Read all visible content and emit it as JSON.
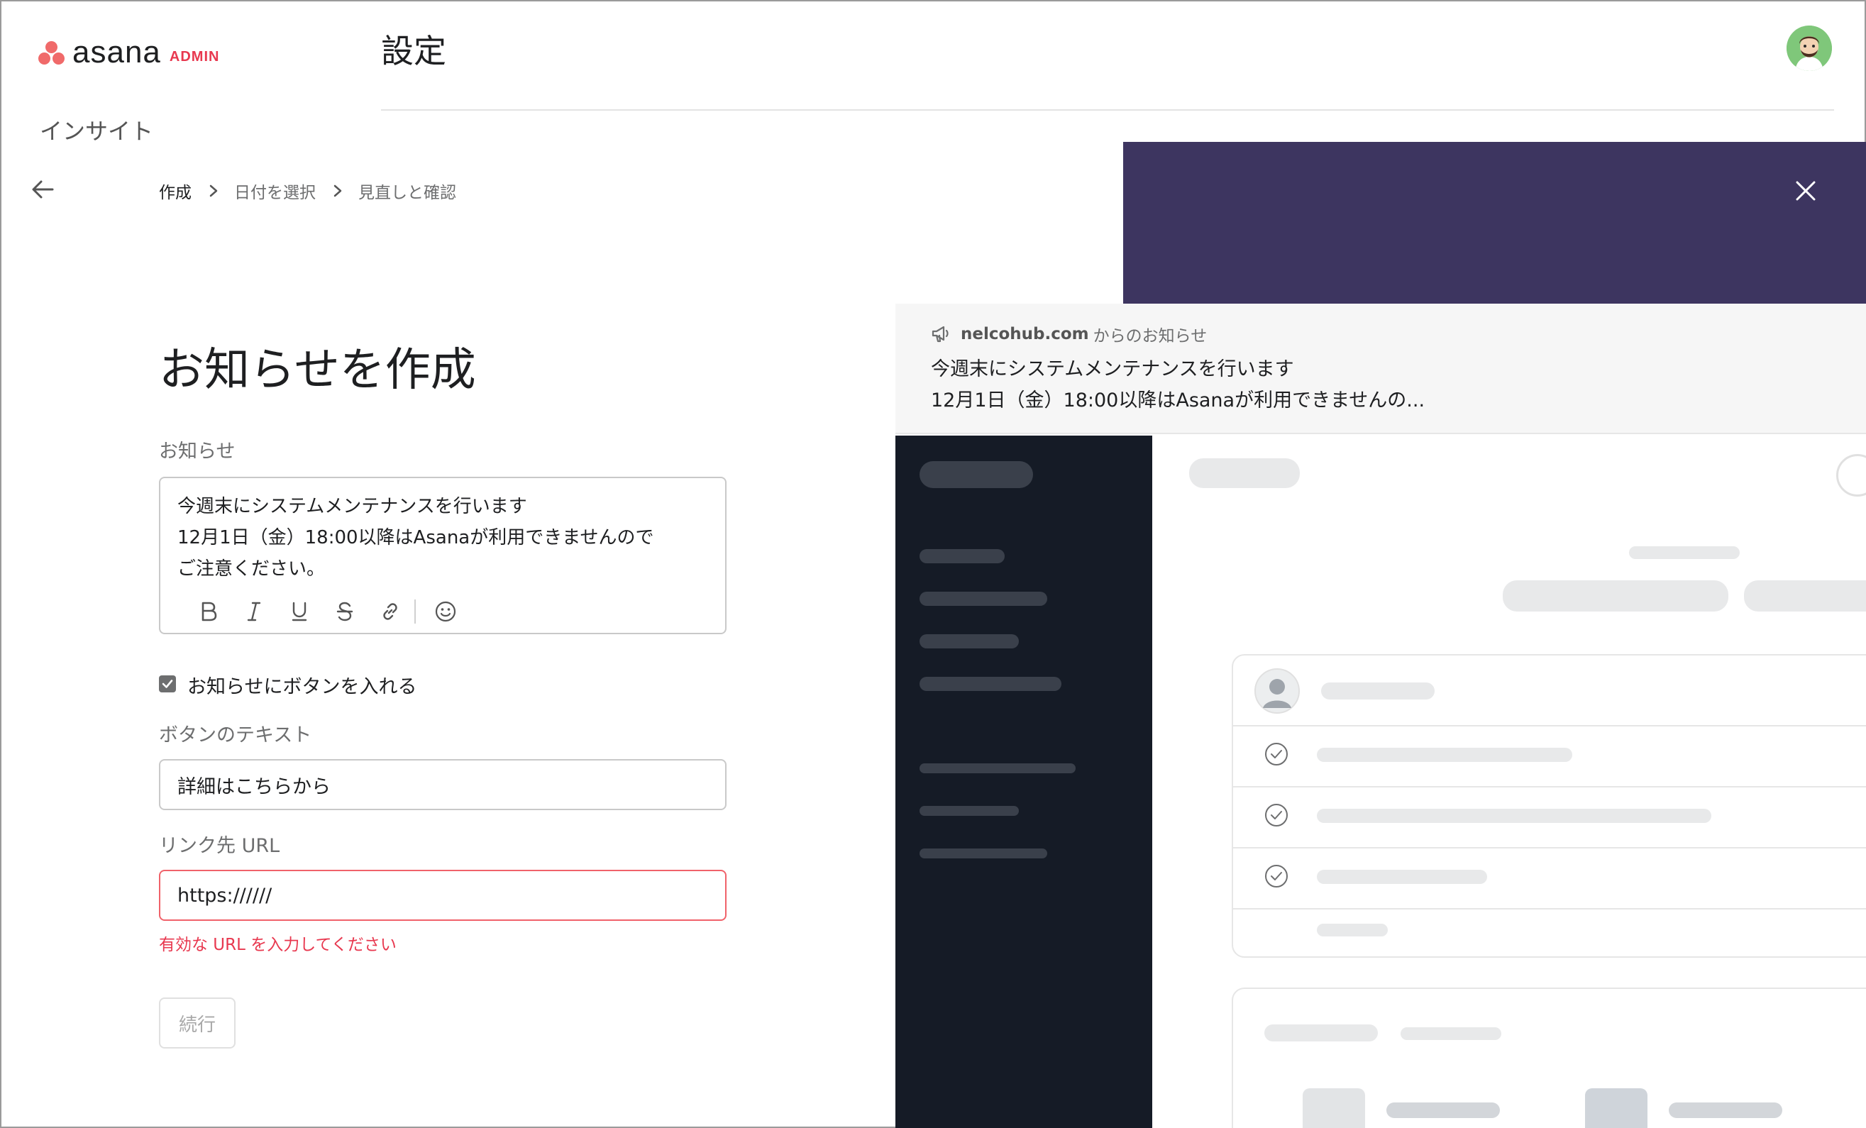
{
  "header": {
    "logo_word": "asana",
    "logo_badge": "ADMIN",
    "page_title": "設定",
    "section": "インサイト"
  },
  "breadcrumb": {
    "steps": [
      "作成",
      "日付を選択",
      "見直しと確認"
    ],
    "active_index": 0
  },
  "form": {
    "title": "お知らせを作成",
    "notice_label": "お知らせ",
    "notice_lines": [
      "今週末にシステムメンテナンスを行います",
      "12月1日（金）18:00以降はAsanaが利用できませんので",
      "ご注意ください。"
    ],
    "toolbar": [
      "bold-icon",
      "italic-icon",
      "underline-icon",
      "strikethrough-icon",
      "link-icon",
      "emoji-icon"
    ],
    "include_button_checked": true,
    "include_button_label": "お知らせにボタンを入れる",
    "button_text_label": "ボタンのテキスト",
    "button_text_value": "詳細はこちらから",
    "url_label": "リンク先 URL",
    "url_value": "https://////",
    "url_error": "有効な URL を入力してください",
    "continue_label": "続行"
  },
  "preview": {
    "banner_domain": "nelcohub.com",
    "banner_from": "からのお知らせ",
    "banner_title": "今週末にシステムメンテナンスを行います",
    "banner_body": "12月1日（金）18:00以降はAsanaが利用できませんの..."
  },
  "colors": {
    "brand": "#f06a6a",
    "error": "#e8384f",
    "preview_header": "#3d3560",
    "preview_sidebar": "#151b26"
  }
}
